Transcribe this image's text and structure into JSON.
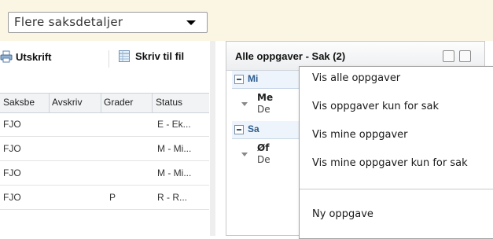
{
  "details_select": {
    "value": "Flere saksdetaljer"
  },
  "toolbar": {
    "print_label": "Utskrift",
    "export_label": "Skriv til fil"
  },
  "table": {
    "columns": [
      "Saksbe",
      "Avskriv",
      "Grader",
      "Status"
    ],
    "rows": [
      [
        "FJO",
        "",
        "",
        "E - Ek..."
      ],
      [
        "FJO",
        "",
        "",
        "M - Mi..."
      ],
      [
        "FJO",
        "",
        "",
        "M - Mi..."
      ],
      [
        "FJO",
        "",
        "P",
        "R - R..."
      ]
    ]
  },
  "tasks_panel": {
    "title": "Alle oppgaver - Sak (2)",
    "groups": [
      {
        "label": "Mi",
        "item": {
          "title": "Me",
          "subtitle": "De"
        }
      },
      {
        "label": "Sa",
        "item": {
          "title": "Øf",
          "subtitle": "De"
        }
      }
    ]
  },
  "context_menu": {
    "items": [
      "Vis alle oppgaver",
      "Vis oppgaver kun for sak",
      "Vis mine oppgaver",
      "Vis mine oppgaver kun for sak"
    ],
    "new_item": "Ny oppgave"
  },
  "icons": [
    "printer-icon",
    "spreadsheet-icon",
    "chevron-down-icon",
    "collapse-icon",
    "expand-icon"
  ]
}
